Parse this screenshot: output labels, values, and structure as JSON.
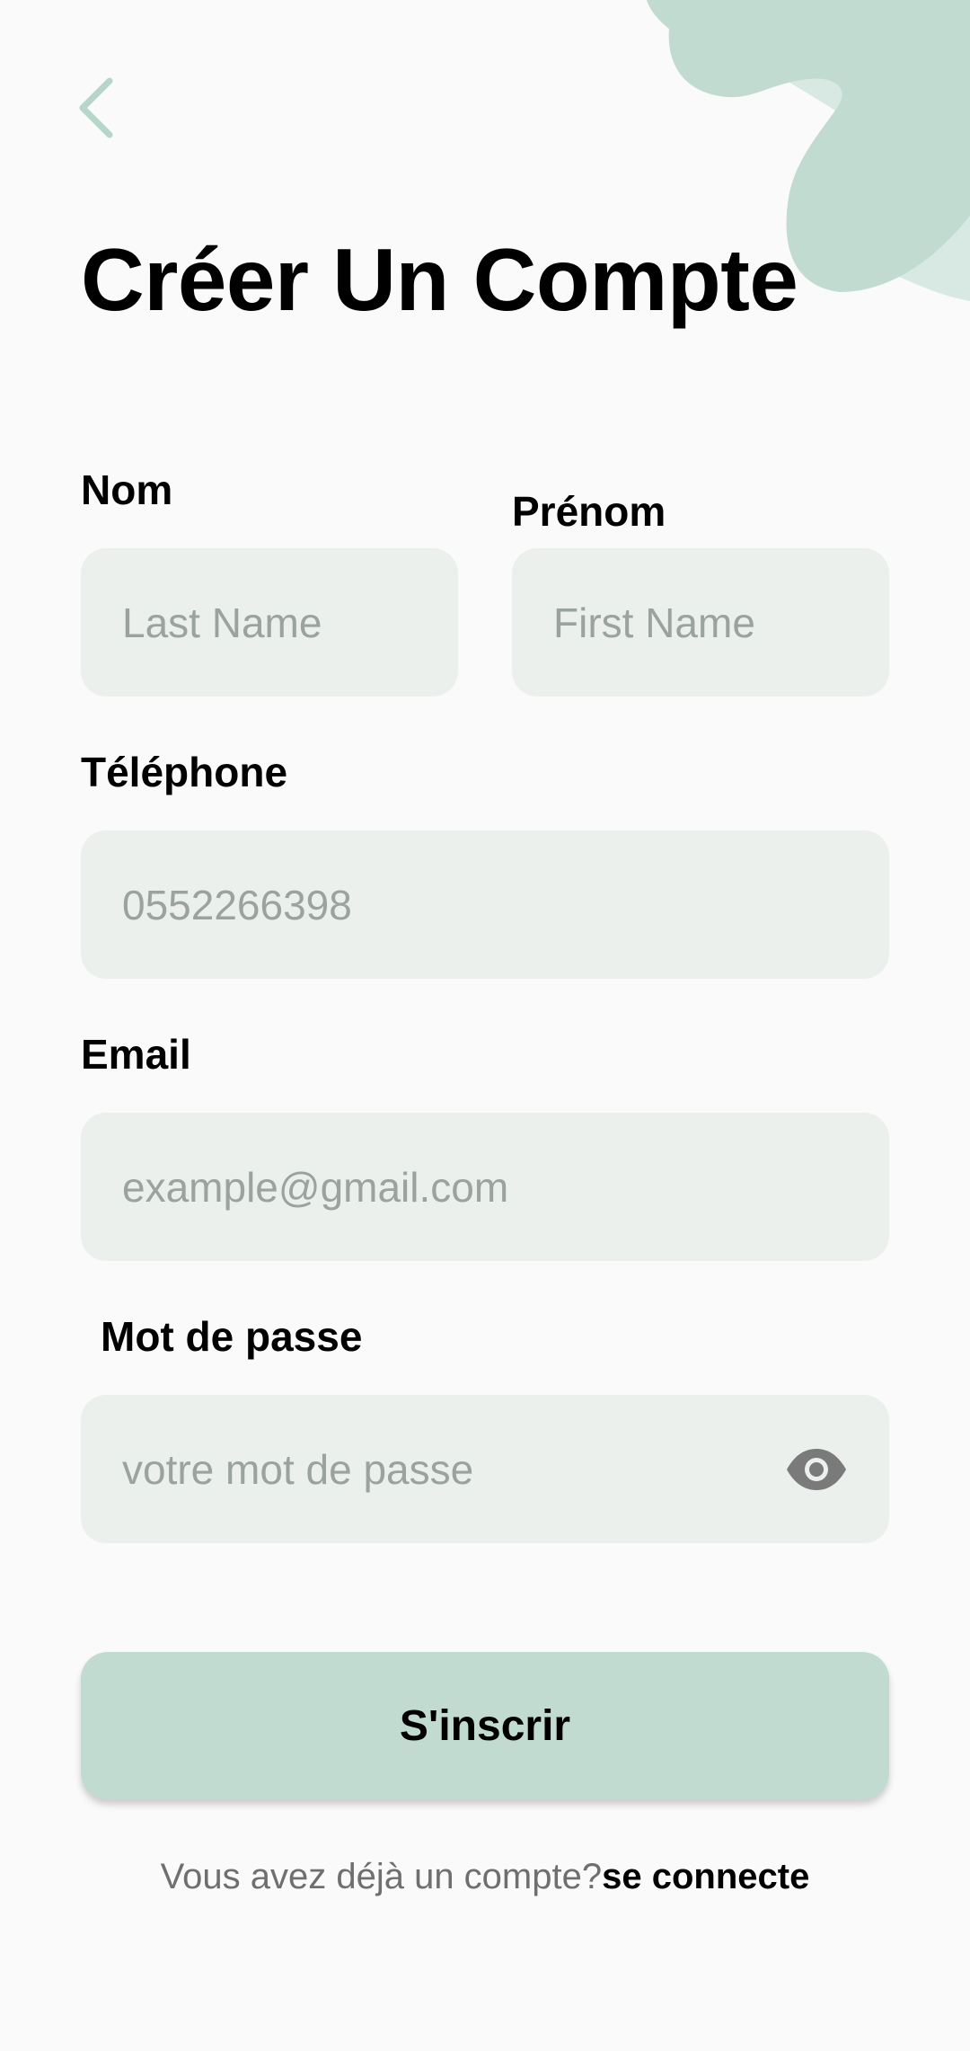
{
  "colors": {
    "background": "#fafafa",
    "accent": "#c1dbd0",
    "field_bg": "#ebf0ed",
    "placeholder": "#9aa39f",
    "eye_icon": "#7a7a7a"
  },
  "header": {
    "back_icon": "chevron-left-icon",
    "title": "Créer Un Compte"
  },
  "form": {
    "last_name": {
      "label": "Nom",
      "placeholder": "Last Name"
    },
    "first_name": {
      "label": "Prénom",
      "placeholder": "First Name"
    },
    "phone": {
      "label": "Téléphone",
      "placeholder": "0552266398"
    },
    "email": {
      "label": "Email",
      "placeholder": "example@gmail.com"
    },
    "password": {
      "label": "Mot de passe",
      "placeholder": "votre mot de passe",
      "toggle_icon": "eye-icon"
    }
  },
  "submit_label": "S'inscrir",
  "footer": {
    "question": "Vous avez déjà un compte?",
    "link": "se connecte"
  }
}
